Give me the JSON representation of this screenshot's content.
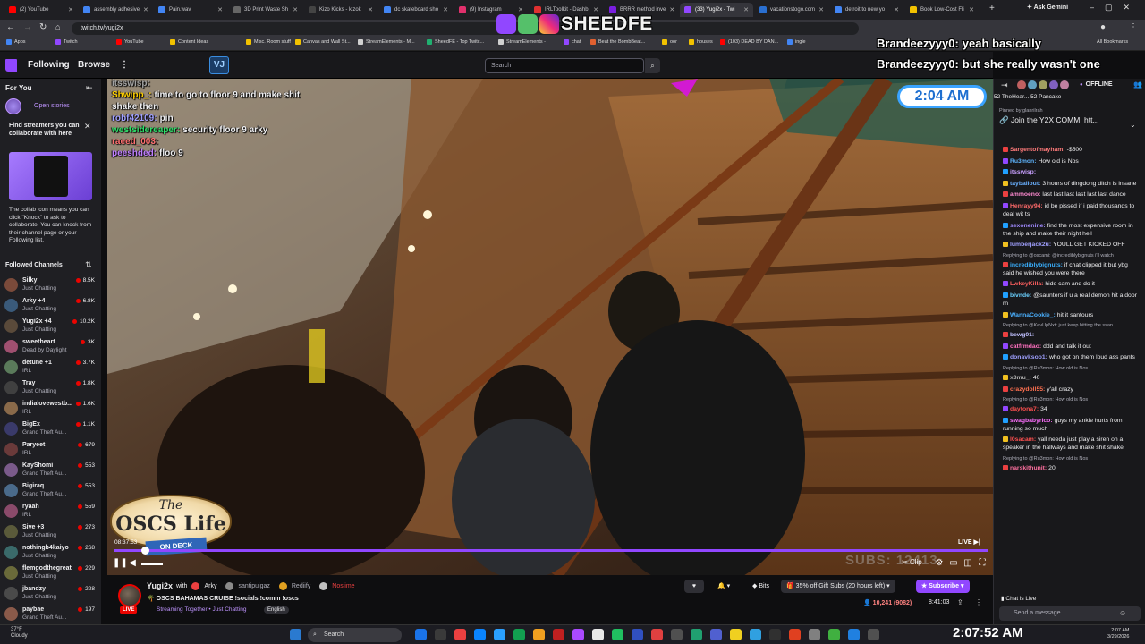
{
  "browser": {
    "tabs": [
      {
        "label": "(2) YouTube",
        "color": "#ff0000"
      },
      {
        "label": "assembly adhesive",
        "color": "#4285f4"
      },
      {
        "label": "Pain.wav",
        "color": "#4285f4"
      },
      {
        "label": "3D Print Waste Sh",
        "color": "#666666"
      },
      {
        "label": "Kizo Kicks - kizok",
        "color": "#444444"
      },
      {
        "label": "dc skateboard sho",
        "color": "#4285f4"
      },
      {
        "label": "(9) Instagram",
        "color": "#e1306c"
      },
      {
        "label": "IRLToolkit - Dashb",
        "color": "#e03030"
      },
      {
        "label": "BRRR method inve",
        "color": "#7a1ee0"
      },
      {
        "label": "(33) Yugi2x - Twi",
        "color": "#9147ff"
      },
      {
        "label": "vacationstogo.com",
        "color": "#2a6fd0"
      },
      {
        "label": "detroit to new yo",
        "color": "#4285f4"
      },
      {
        "label": "Book Low-Cost Fli",
        "color": "#f2c200"
      }
    ],
    "new_tab": "+",
    "ask_gemini": "Ask Gemini",
    "url": "twitch.tv/yugi2x",
    "bookmarks": [
      "Apps",
      "Twitch",
      "YouTube",
      "Content Ideas",
      "Misc. Room stuff",
      "Canvas and Wall St...",
      "StreamElements - M...",
      "SheedFE - Top Twitc...",
      "StreamElements -",
      "chat",
      "Beat the BombBeat...",
      "oor",
      "houses",
      "(103) DEAD BY DAN...",
      "ingle"
    ],
    "all_bookmarks": "All Bookmarks"
  },
  "watermark": "SHEEDFE",
  "twitch_nav": {
    "following": "Following",
    "browse": "Browse",
    "more": "⋮",
    "search_placeholder": "Search",
    "vj_badge": "VJ"
  },
  "sidebar": {
    "for_you": "For You",
    "open_stories": "Open stories",
    "card_title": "Find streamers you can collaborate with here",
    "card_body": "The collab icon means you can click \"Knock\" to ask to collaborate. You can knock from their channel page or your Following list.",
    "followed_title": "Followed Channels",
    "channels": [
      {
        "name": "Silky",
        "game": "Just Chatting",
        "viewers": "8.5K",
        "color": "#7a4a3a"
      },
      {
        "name": "Arky +4",
        "game": "Just Chatting",
        "viewers": "6.8K",
        "color": "#3a5a7a"
      },
      {
        "name": "Yugi2x +4",
        "game": "Just Chatting",
        "viewers": "10.2K",
        "color": "#5a4a3a"
      },
      {
        "name": "sweetheart",
        "game": "Dead by Daylight",
        "viewers": "3K",
        "color": "#a05070"
      },
      {
        "name": "detune +1",
        "game": "IRL",
        "viewers": "3.7K",
        "color": "#5a7a5a"
      },
      {
        "name": "Tray",
        "game": "Just Chatting",
        "viewers": "1.8K",
        "color": "#404040"
      },
      {
        "name": "indialovewestb...",
        "game": "IRL",
        "viewers": "1.6K",
        "color": "#8a6a4a"
      },
      {
        "name": "BigEx",
        "game": "Grand Theft Au...",
        "viewers": "1.1K",
        "color": "#3a3a6a"
      },
      {
        "name": "Paryeet",
        "game": "IRL",
        "viewers": "679",
        "color": "#6a3a3a"
      },
      {
        "name": "KayShomi",
        "game": "Grand Theft Au...",
        "viewers": "553",
        "color": "#7a5a8a"
      },
      {
        "name": "Bigiraq",
        "game": "Grand Theft Au...",
        "viewers": "553",
        "color": "#4a6a8a"
      },
      {
        "name": "ryaah",
        "game": "IRL",
        "viewers": "559",
        "color": "#8a4a6a"
      },
      {
        "name": "Sive +3",
        "game": "Just Chatting",
        "viewers": "273",
        "color": "#5a5a3a"
      },
      {
        "name": "nothingb4kaiyo",
        "game": "Just Chatting",
        "viewers": "268",
        "color": "#3a6a6a"
      },
      {
        "name": "flemgodthegreat",
        "game": "Just Chatting",
        "viewers": "229",
        "color": "#6a6a3a"
      },
      {
        "name": "jbandzy",
        "game": "Just Chatting",
        "viewers": "228",
        "color": "#4a4a4a"
      },
      {
        "name": "paybae",
        "game": "Grand Theft Au...",
        "viewers": "197",
        "color": "#8a5a4a"
      }
    ]
  },
  "overlay": {
    "top_chat": [
      {
        "user": "Brandeezyyy0:",
        "text": "yeah basically"
      },
      {
        "user": "Brandeezyyy0:",
        "text": "but she really wasn't one"
      }
    ],
    "clock": "2:04 AM",
    "stream_chat": [
      {
        "user": "itsswisp:",
        "text": "",
        "color": "#a0a0a0"
      },
      {
        "user": "Shwipp_:",
        "text": "time to go to floor 9 and make shit shake then",
        "color": "#ffd000"
      },
      {
        "user": "robf42109:",
        "text": "pin",
        "color": "#a0a0ff"
      },
      {
        "user": "westsidereaper:",
        "text": "security floor 9 arky",
        "color": "#2ee06a"
      },
      {
        "user": "raeed_003:",
        "text": "",
        "color": "#ff7070"
      },
      {
        "user": "peeshded:",
        "text": "floo 9",
        "color": "#c080ff"
      }
    ],
    "oscs_the": "The",
    "oscs_life": "OSCS Life",
    "oscs_deck": "ON DECK",
    "subs_watermark": "SUBS: 12413"
  },
  "player": {
    "timestamp": "08:37:53",
    "live_label": "LIVE",
    "clip": "Clip",
    "progress_pct": 100
  },
  "channel": {
    "name": "Yugi2x",
    "with": "with",
    "collabs": [
      "Arky",
      "santipuigaz",
      "Rediify",
      "Nosiime"
    ],
    "title": "OSCS BAHAMAS CRUISE  !socials !comm !oscs",
    "category": "Streaming Together • Just Chatting",
    "language": "English",
    "live": "LIVE",
    "bits": "Bits",
    "gift_subs": "35% off Gift Subs (20 hours left)",
    "subscribe": "Subscribe",
    "viewers": "10,241 (9082)",
    "uptime": "8:41:03"
  },
  "chat": {
    "status": "OFFLINE",
    "hype": "52  TheHear...  52  Pancake",
    "pinned_by": "Pinned by glanrilrah",
    "pinned_text": "Join the Y2X COMM: htt...",
    "messages": [
      {
        "user": "Sargentofmayham:",
        "text": "-$500",
        "color": "#ff7a7a",
        "reply": ""
      },
      {
        "user": "Ru3mon:",
        "text": "How old is Nos",
        "color": "#5fb6ff",
        "reply": ""
      },
      {
        "user": "itsswisp:",
        "text": "",
        "color": "#c8a0ff",
        "reply": ""
      },
      {
        "user": "tayballout:",
        "text": "3 hours of dingdong ditch is insane",
        "color": "#6ab0ff",
        "reply": ""
      },
      {
        "user": "ammoeno:",
        "text": "last last last last last last dance",
        "color": "#ff8ad0",
        "reply": ""
      },
      {
        "user": "Henrayy94:",
        "text": "id be pissed if i paid thousands to deal wit ts",
        "color": "#ff6a6a",
        "reply": ""
      },
      {
        "user": "sexonenine:",
        "text": "find the most expensive room in the ship and make their night hell",
        "color": "#a08aff",
        "reply": ""
      },
      {
        "user": "lumberjack2u:",
        "text": "YOULL GET KICKED OFF",
        "color": "#a0a0ff",
        "reply": ""
      },
      {
        "user": "incrediblybignuts:",
        "text": "if chat clipped it but ybg said he wished you were there",
        "color": "#3ab0ff",
        "reply": "Replying to @oscami: @incrediblybignuts i'll watch"
      },
      {
        "user": "LwkeyKilla:",
        "text": "hide cam and do it",
        "color": "#ff6060",
        "reply": ""
      },
      {
        "user": "bivnde:",
        "text": "@saunters if u a real demon hit a door rn",
        "color": "#6ad0ff",
        "reply": ""
      },
      {
        "user": "WannaCookie_:",
        "text": "hit it santours",
        "color": "#4ab0ff",
        "reply": ""
      },
      {
        "user": "bewg01:",
        "text": "",
        "color": "#c0c0ff",
        "reply": "Replying to @KevUpNxt: just keep hitting the ssan"
      },
      {
        "user": "catfrmdao:",
        "text": "ddd and talk it out",
        "color": "#ff70c0",
        "reply": ""
      },
      {
        "user": "donavksoo1:",
        "text": "who got on them loud ass pants",
        "color": "#9fa0ff",
        "reply": ""
      },
      {
        "user": "x3mu_:",
        "text": "40",
        "color": "#b0b0b0",
        "reply": "Replying to @Ru3mon: How old is Nos"
      },
      {
        "user": "crazydoll55:",
        "text": "y'all crazy",
        "color": "#ff7050",
        "reply": ""
      },
      {
        "user": "daytona7:",
        "text": "34",
        "color": "#ff5050",
        "reply": "Replying to @Ru3mon: How old is Nos"
      },
      {
        "user": "swagbabyrico:",
        "text": "guys my ankle hurts from running so much",
        "color": "#ff70ff",
        "reply": ""
      },
      {
        "user": "l0sacam:",
        "text": "yall needa just play a siren on a speaker in the hallways and make shit shake",
        "color": "#ff5050",
        "reply": ""
      },
      {
        "user": "narskithunit:",
        "text": "20",
        "color": "#ff70a0",
        "reply": "Replying to @Ru3mon: How old is Nos"
      }
    ],
    "live_status": "Chat is Live",
    "input_placeholder": "Send a message"
  },
  "taskbar": {
    "temp": "37°F",
    "weather": "Cloudy",
    "search": "Search",
    "time": "2:07:52 AM",
    "sys_time": "2:07 AM",
    "date": "3/29/2026"
  }
}
